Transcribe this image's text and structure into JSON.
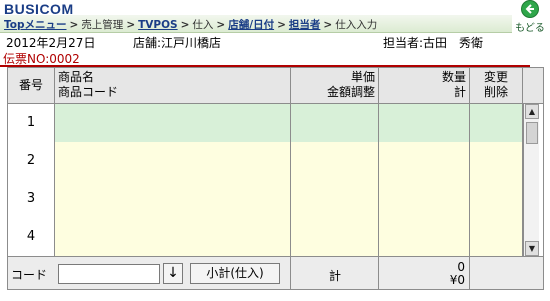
{
  "app": {
    "brand": "BUSICOM",
    "back_label": "もどる"
  },
  "breadcrumb": [
    {
      "label": "Topメニュー",
      "link": true
    },
    {
      "label": "売上管理",
      "link": false
    },
    {
      "label": "TVPOS",
      "link": true
    },
    {
      "label": "仕入",
      "link": false
    },
    {
      "label": "店舗/日付",
      "link": true
    },
    {
      "label": "担当者",
      "link": true
    },
    {
      "label": "仕入入力",
      "link": false
    }
  ],
  "breadcrumb_sep": ">",
  "info": {
    "date": "2012年2月27日",
    "store": "店舗:江戸川橋店",
    "staff": "担当者:古田　秀衛"
  },
  "slip": {
    "label": "伝票NO:0002"
  },
  "table": {
    "headers": {
      "number": "番号",
      "product_name": "商品名",
      "product_code": "商品コード",
      "unit_price": "単価",
      "amount_adjust": "金額調整",
      "quantity": "数量",
      "subtotal": "計",
      "change": "変更",
      "delete": "削除"
    },
    "rows": [
      {
        "no": "1",
        "highlighted": true
      },
      {
        "no": "2",
        "highlighted": false
      },
      {
        "no": "3",
        "highlighted": false
      },
      {
        "no": "4",
        "highlighted": false
      }
    ]
  },
  "footer": {
    "code_label": "コード",
    "code_value": "",
    "arrow_label": "↓",
    "subtotal_button": "小計(仕入)",
    "total_label": "計",
    "total_qty": "0",
    "total_amount": "¥0"
  },
  "colors": {
    "row_highlight": "#d8f0d8",
    "row_normal": "#fefee0",
    "brand": "#1a3d86",
    "accent_red": "#b00000"
  }
}
